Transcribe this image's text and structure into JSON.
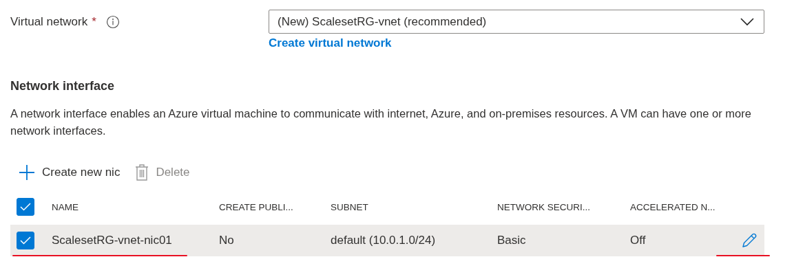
{
  "virtual_network": {
    "label": "Virtual network",
    "required_mark": "*",
    "dropdown_value": "(New) ScalesetRG-vnet (recommended)",
    "create_link": "Create virtual network"
  },
  "network_interface": {
    "heading": "Network interface",
    "description": "A network interface enables an Azure virtual machine to communicate with internet, Azure, and on-premises resources. A VM can have one or more network interfaces."
  },
  "toolbar": [
    {
      "kind": "add",
      "label": "Create new nic",
      "disabled": false
    },
    {
      "kind": "delete",
      "label": "Delete",
      "disabled": true
    }
  ],
  "table": {
    "select_all_checked": true,
    "columns": [
      "NAME",
      "CREATE PUBLI...",
      "SUBNET",
      "NETWORK SECURI...",
      "ACCELERATED N..."
    ],
    "rows": [
      {
        "checked": true,
        "selected": true,
        "cells": [
          "ScalesetRG-vnet-nic01",
          "No",
          "default (10.0.1.0/24)",
          "Basic",
          "Off"
        ]
      }
    ]
  }
}
